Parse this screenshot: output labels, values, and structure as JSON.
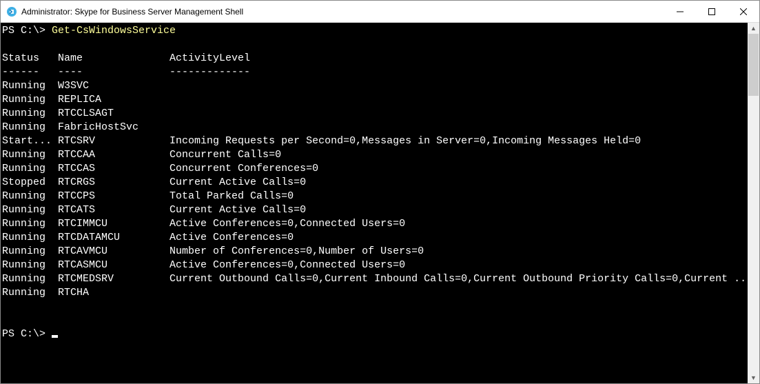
{
  "window": {
    "title": "Administrator: Skype for Business Server Management Shell"
  },
  "prompt_first": "PS C:\\> ",
  "command": "Get-CsWindowsService",
  "headers": {
    "status": "Status",
    "name": "Name",
    "activity": "ActivityLevel"
  },
  "rules": {
    "status": "------",
    "name": "----",
    "activity": "-------------"
  },
  "rows": [
    {
      "status": "Running",
      "name": "W3SVC",
      "activity": ""
    },
    {
      "status": "Running",
      "name": "REPLICA",
      "activity": ""
    },
    {
      "status": "Running",
      "name": "RTCCLSAGT",
      "activity": ""
    },
    {
      "status": "Running",
      "name": "FabricHostSvc",
      "activity": ""
    },
    {
      "status": "Start...",
      "name": "RTCSRV",
      "activity": "Incoming Requests per Second=0,Messages in Server=0,Incoming Messages Held=0"
    },
    {
      "status": "Running",
      "name": "RTCCAA",
      "activity": "Concurrent Calls=0"
    },
    {
      "status": "Running",
      "name": "RTCCAS",
      "activity": "Concurrent Conferences=0"
    },
    {
      "status": "Stopped",
      "name": "RTCRGS",
      "activity": "Current Active Calls=0"
    },
    {
      "status": "Running",
      "name": "RTCCPS",
      "activity": "Total Parked Calls=0"
    },
    {
      "status": "Running",
      "name": "RTCATS",
      "activity": "Current Active Calls=0"
    },
    {
      "status": "Running",
      "name": "RTCIMMCU",
      "activity": "Active Conferences=0,Connected Users=0"
    },
    {
      "status": "Running",
      "name": "RTCDATAMCU",
      "activity": "Active Conferences=0"
    },
    {
      "status": "Running",
      "name": "RTCAVMCU",
      "activity": "Number of Conferences=0,Number of Users=0"
    },
    {
      "status": "Running",
      "name": "RTCASMCU",
      "activity": "Active Conferences=0,Connected Users=0"
    },
    {
      "status": "Running",
      "name": "RTCMEDSRV",
      "activity": "Current Outbound Calls=0,Current Inbound Calls=0,Current Outbound Priority Calls=0,Current ..."
    },
    {
      "status": "Running",
      "name": "RTCHA",
      "activity": ""
    }
  ],
  "prompt_last": "PS C:\\> ",
  "cols": {
    "status_w": 9,
    "name_w": 18
  }
}
